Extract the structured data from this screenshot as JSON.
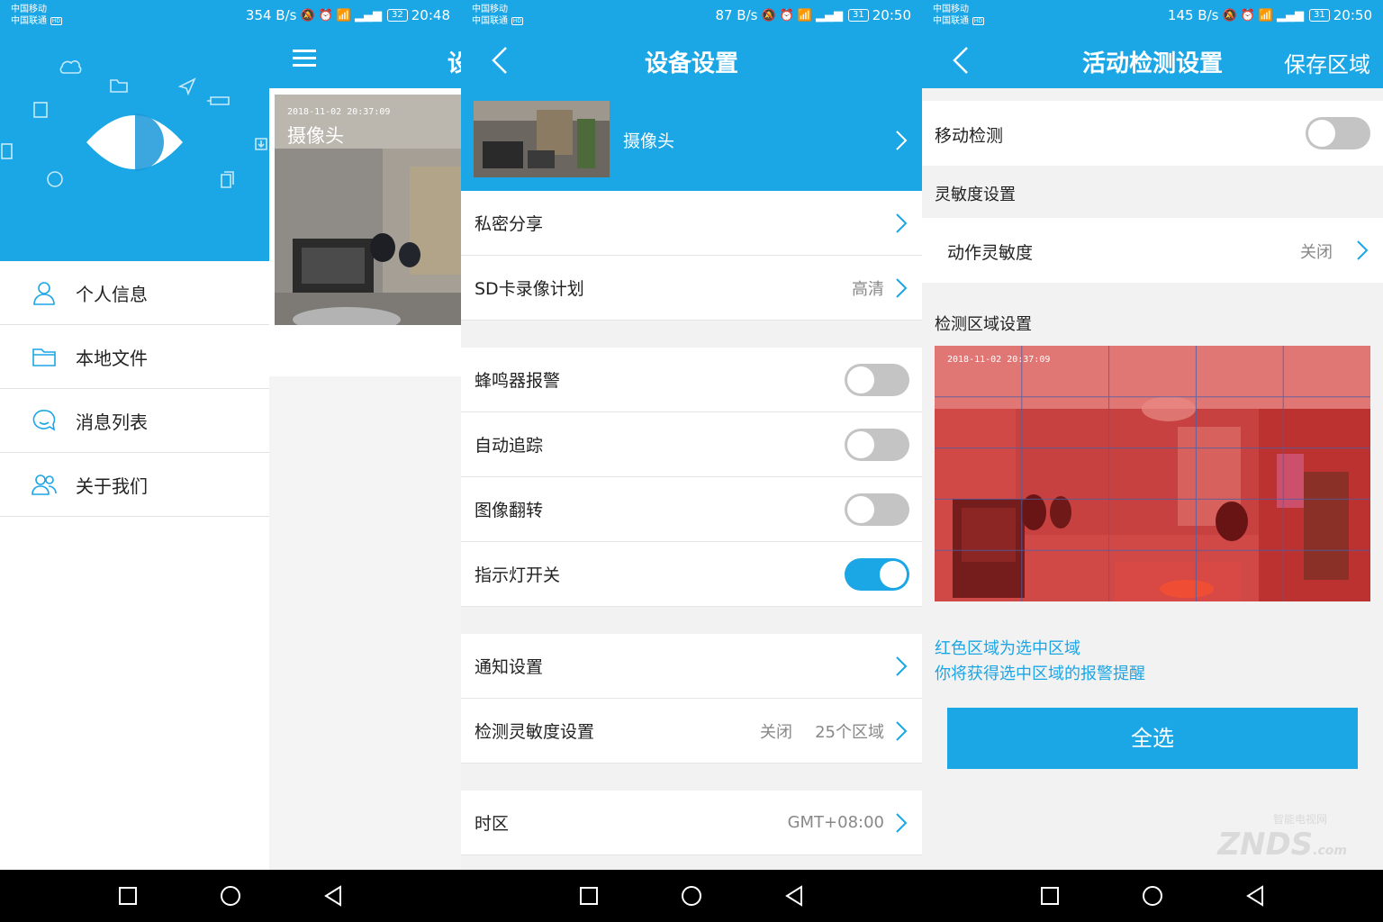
{
  "colors": {
    "accent": "#1ba6e5",
    "toggle_off": "#c4c4c4",
    "area_red": "#d9413e"
  },
  "panel1": {
    "status": {
      "carrier1": "中国移动",
      "carrier2": "中国联通",
      "speed": "354 B/s",
      "battery": "32",
      "time": "20:48"
    },
    "menu": [
      {
        "label": "个人信息",
        "icon": "person-icon"
      },
      {
        "label": "本地文件",
        "icon": "folder-icon"
      },
      {
        "label": "消息列表",
        "icon": "message-icon"
      },
      {
        "label": "关于我们",
        "icon": "group-icon"
      }
    ],
    "behind": {
      "timestamp": "2018-11-02 20:37:09",
      "camera_name": "摄像头",
      "title_fragment": "设"
    }
  },
  "panel2": {
    "status": {
      "carrier1": "中国移动",
      "carrier2": "中国联通",
      "speed": "87 B/s",
      "battery": "31",
      "time": "20:50"
    },
    "title": "设备设置",
    "device_name": "摄像头",
    "rows": {
      "private_share": {
        "label": "私密分享"
      },
      "sd_record": {
        "label": "SD卡录像计划",
        "value": "高清"
      },
      "buzzer": {
        "label": "蜂鸣器报警",
        "on": false
      },
      "auto_track": {
        "label": "自动追踪",
        "on": false
      },
      "image_flip": {
        "label": "图像翻转",
        "on": false
      },
      "indicator_light": {
        "label": "指示灯开关",
        "on": true
      },
      "notify": {
        "label": "通知设置"
      },
      "detect_sens": {
        "label": "检测灵敏度设置",
        "value1": "关闭",
        "value2": "25个区域"
      },
      "timezone": {
        "label": "时区",
        "value": "GMT+08:00"
      }
    }
  },
  "panel3": {
    "status": {
      "carrier1": "中国移动",
      "carrier2": "中国联通",
      "speed": "145 B/s",
      "battery": "31",
      "time": "20:50"
    },
    "title": "活动检测设置",
    "save_label": "保存区域",
    "motion_detect": {
      "label": "移动检测",
      "on": false
    },
    "sensitivity_section": "灵敏度设置",
    "action_sensitivity": {
      "label": "动作灵敏度",
      "value": "关闭"
    },
    "area_section": "检测区域设置",
    "area_timestamp": "2018-11-02 20:37:09",
    "hint_line1": "红色区域为选中区域",
    "hint_line2": "你将获得选中区域的报警提醒",
    "select_all": "全选",
    "watermark": "ZNDS",
    "watermark_suffix": ".com",
    "watermark_top": "智能电视网"
  }
}
